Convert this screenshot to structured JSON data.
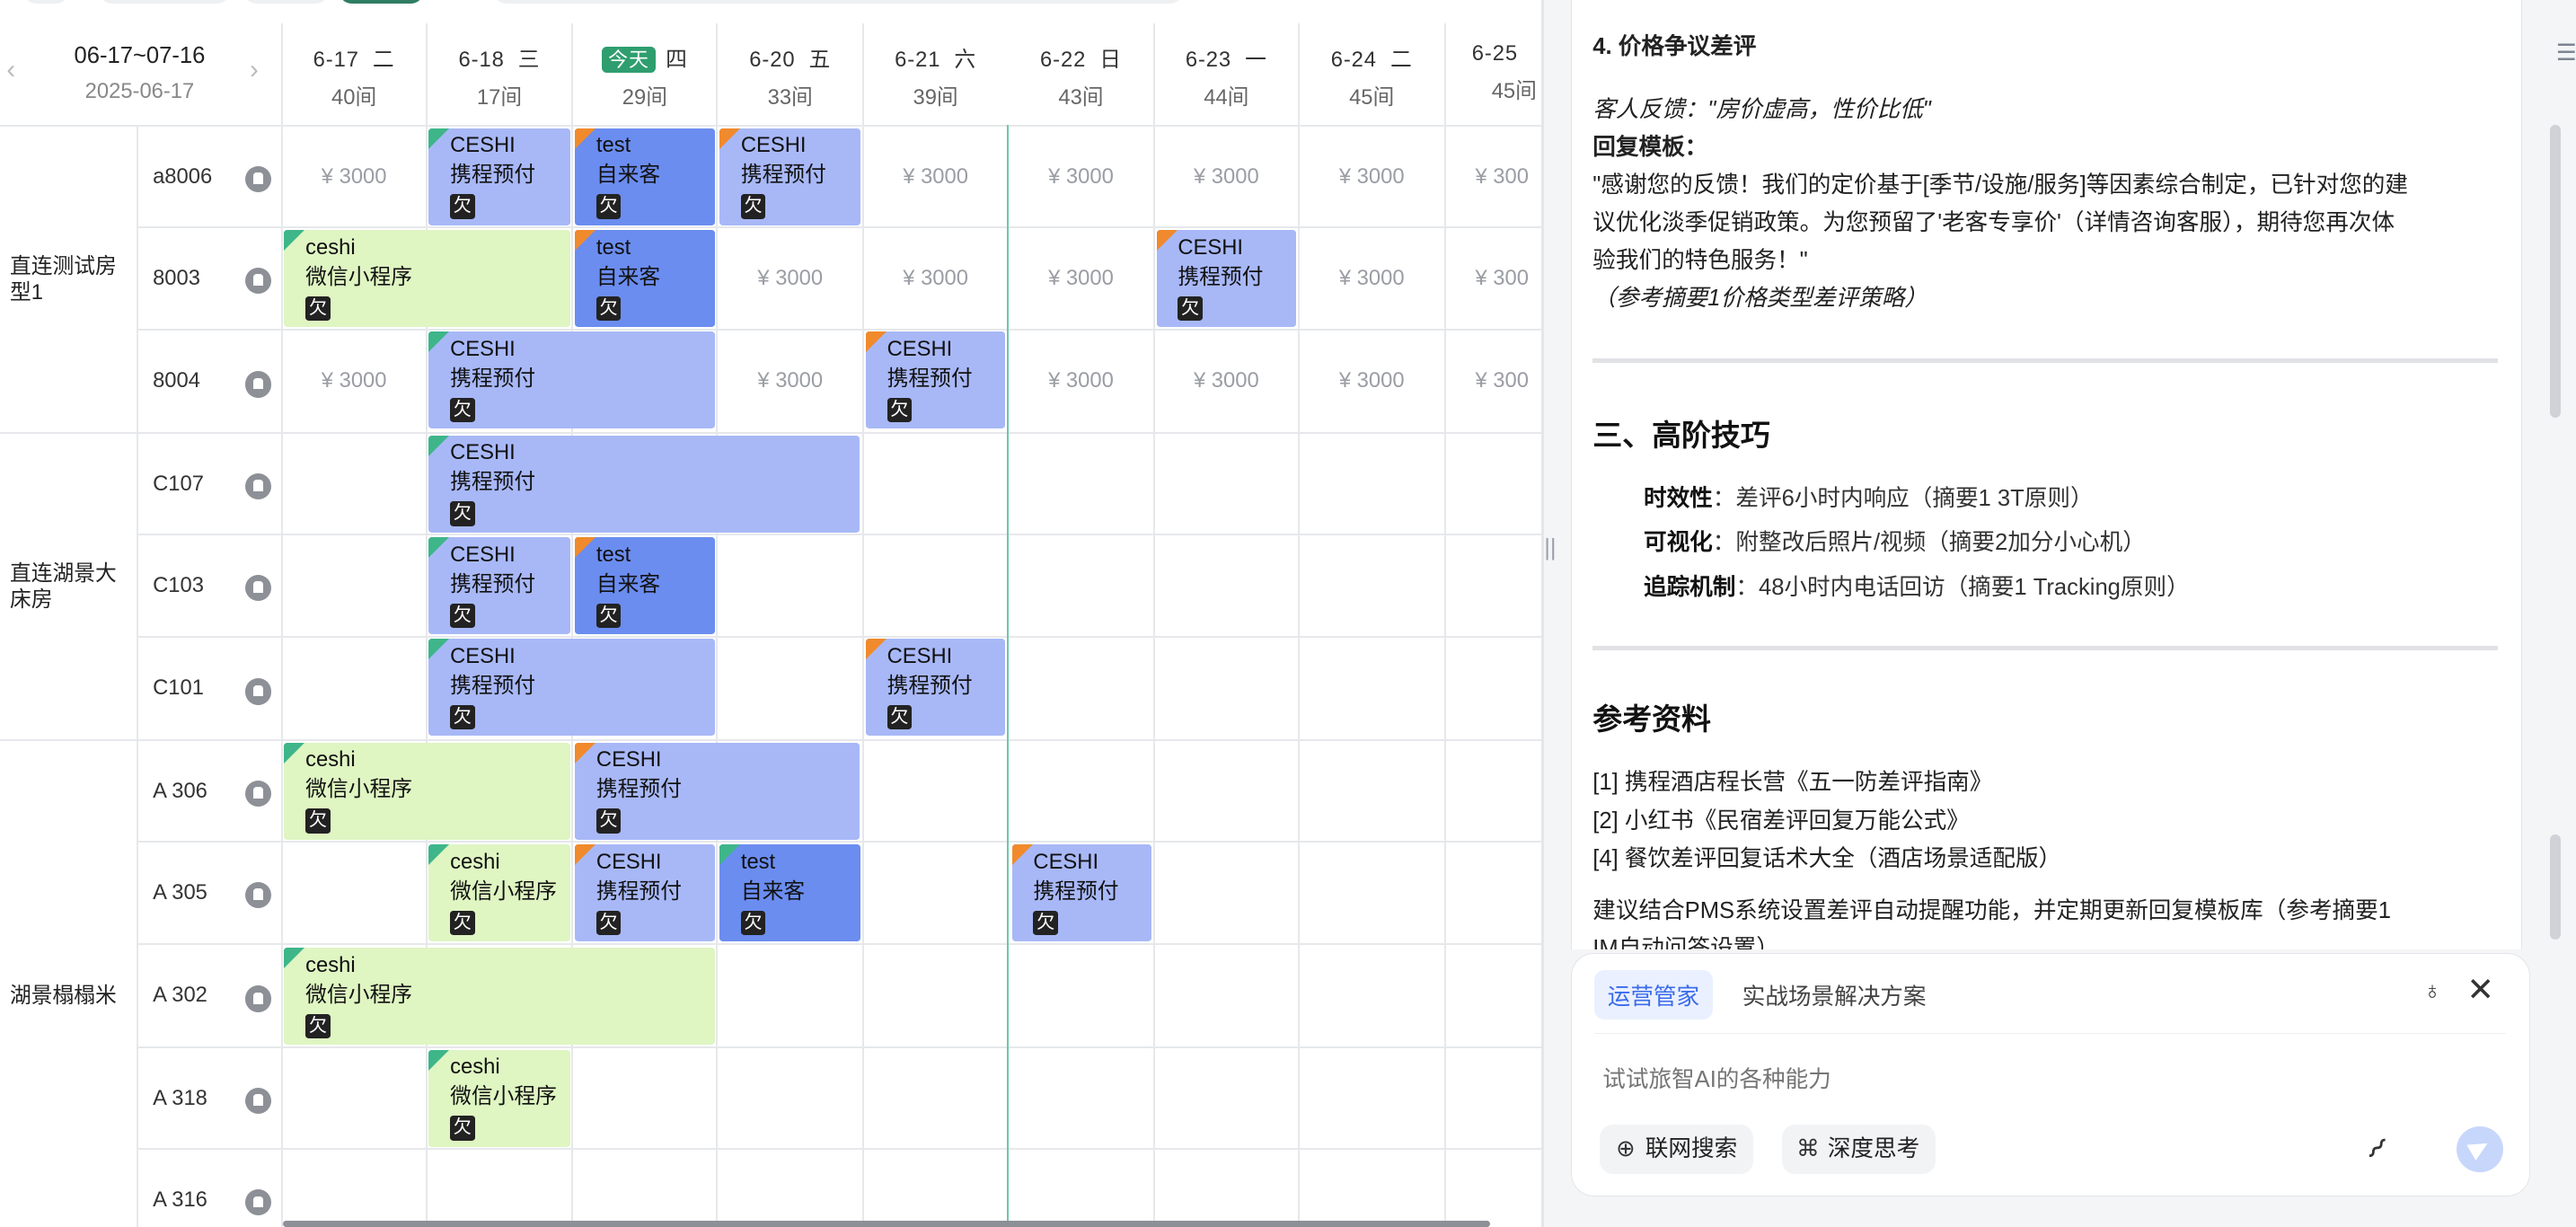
{
  "calendar": {
    "range": "06-17~07-16",
    "current_date": "2025-06-17",
    "today_label": "今天",
    "days": [
      {
        "date": "6-17",
        "weekday": "二",
        "count": "40间"
      },
      {
        "date": "6-18",
        "weekday": "三",
        "count": "17间"
      },
      {
        "date": "",
        "weekday": "四",
        "count": "29间",
        "today": true
      },
      {
        "date": "6-20",
        "weekday": "五",
        "count": "33间"
      },
      {
        "date": "6-21",
        "weekday": "六",
        "count": "39间"
      },
      {
        "date": "6-22",
        "weekday": "日",
        "count": "43间"
      },
      {
        "date": "6-23",
        "weekday": "一",
        "count": "44间"
      },
      {
        "date": "6-24",
        "weekday": "二",
        "count": "45间"
      },
      {
        "date": "6-25",
        "weekday": "",
        "count": "45间"
      }
    ],
    "room_types": [
      "直连测试房型1",
      "直连湖景大床房",
      "湖景榻榻米"
    ],
    "rooms": [
      "a8006",
      "8003",
      "8004",
      "C107",
      "C103",
      "C101",
      "A 306",
      "A 305",
      "A 302",
      "A 318",
      "A 316"
    ],
    "price": "¥ 3000",
    "price_trunc": "¥ 300",
    "owe_label": "欠",
    "bookings": [
      {
        "name": "CESHI",
        "channel": "携程预付"
      },
      {
        "name": "test",
        "channel": "自来客"
      },
      {
        "name": "CESHI",
        "channel": "携程预付"
      },
      {
        "name": "ceshi",
        "channel": "微信小程序"
      },
      {
        "name": "test",
        "channel": "自来客"
      },
      {
        "name": "CESHI",
        "channel": "携程预付"
      },
      {
        "name": "CESHI",
        "channel": "携程预付"
      },
      {
        "name": "CESHI",
        "channel": "携程预付"
      },
      {
        "name": "CESHI",
        "channel": "携程预付"
      },
      {
        "name": "CESHI",
        "channel": "携程预付"
      },
      {
        "name": "test",
        "channel": "自来客"
      },
      {
        "name": "CESHI",
        "channel": "携程预付"
      },
      {
        "name": "CESHI",
        "channel": "携程预付"
      },
      {
        "name": "ceshi",
        "channel": "微信小程序"
      },
      {
        "name": "CESHI",
        "channel": "携程预付"
      },
      {
        "name": "ceshi",
        "channel": "微信小程序"
      },
      {
        "name": "CESHI",
        "channel": "携程预付"
      },
      {
        "name": "test",
        "channel": "自来客"
      },
      {
        "name": "CESHI",
        "channel": "携程预付"
      },
      {
        "name": "ceshi",
        "channel": "微信小程序"
      },
      {
        "name": "ceshi",
        "channel": "微信小程序"
      }
    ]
  },
  "article": {
    "section4_title": "4. 价格争议差评",
    "feedback": "客人反馈：\"房价虚高，性价比低\"",
    "reply_label": "回复模板：",
    "reply_line1": "\"感谢您的反馈！我们的定价基于[季节/设施/服务]等因素综合制定，已针对您的建",
    "reply_line2": "议优化淡季促销政策。为您预留了'老客专享价'（详情咨询客服），期待您再次体",
    "reply_line3": "验我们的特色服务！\"",
    "reply_ref": "（参考摘要1价格类型差评策略）",
    "section3_title": "三、高阶技巧",
    "tips": [
      {
        "label": "时效性",
        "text": "：差评6小时内响应（摘要1 3T原则）"
      },
      {
        "label": "可视化",
        "text": "：附整改后照片/视频（摘要2加分小心机）"
      },
      {
        "label": "追踪机制",
        "text": "：48小时内电话回访（摘要1 Tracking原则）"
      }
    ],
    "refs_title": "参考资料",
    "refs": [
      "[1] 携程酒店程长营《五一防差评指南》",
      "[2] 小红书《民宿差评回复万能公式》",
      "[4] 餐饮差评回复话术大全（酒店场景适配版）"
    ],
    "suggest_line1": "建议结合PMS系统设置差评自动提醒功能，并定期更新回复模板库（参考摘要1",
    "suggest_line2": "IM自动问答设置）"
  },
  "chat": {
    "active_tag": "运营管家",
    "tag": "实战场景解决方案",
    "placeholder": "试试旅智AI的各种能力",
    "web_search": "联网搜索",
    "deep_think": "深度思考"
  },
  "colors": {
    "ctrip": "#a8b8f7",
    "wechat": "#dff5c2",
    "walkin": "#6b8df0",
    "accent": "#2f9e6e"
  }
}
